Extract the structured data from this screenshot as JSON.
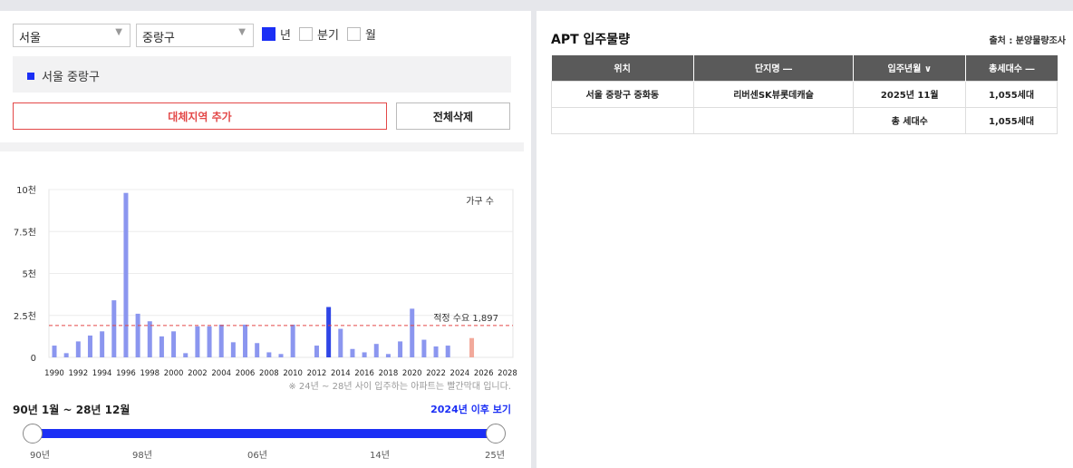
{
  "filters": {
    "city": "서울",
    "district": "중랑구",
    "period_options": [
      {
        "label": "년",
        "checked": true
      },
      {
        "label": "분기",
        "checked": false
      },
      {
        "label": "월",
        "checked": false
      }
    ]
  },
  "regions": [
    "서울 중랑구"
  ],
  "buttons": {
    "add": "대체지역 추가",
    "delete_all": "전체삭제"
  },
  "chart_data": {
    "type": "bar",
    "title": "",
    "legend": "가구 수",
    "yticks": [
      "0",
      "2.5천",
      "5천",
      "7.5천",
      "10천"
    ],
    "ylim": [
      0,
      10000
    ],
    "x": [
      1990,
      1991,
      1992,
      1993,
      1994,
      1995,
      1996,
      1997,
      1998,
      1999,
      2000,
      2001,
      2002,
      2003,
      2004,
      2005,
      2006,
      2007,
      2008,
      2009,
      2010,
      2011,
      2012,
      2013,
      2014,
      2015,
      2016,
      2017,
      2018,
      2019,
      2020,
      2021,
      2022,
      2023,
      2024,
      2025,
      2026,
      2027,
      2028
    ],
    "xticks": [
      "1990",
      "1992",
      "1994",
      "1996",
      "1998",
      "2000",
      "2002",
      "2004",
      "2006",
      "2008",
      "2010",
      "2012",
      "2014",
      "2016",
      "2018",
      "2020",
      "2022",
      "2024",
      "2026",
      "2028"
    ],
    "values": [
      700,
      250,
      950,
      1300,
      1550,
      3400,
      9800,
      2600,
      2150,
      1250,
      1550,
      250,
      1850,
      1850,
      1950,
      900,
      1950,
      850,
      300,
      200,
      1950,
      0,
      700,
      3000,
      1700,
      500,
      300,
      800,
      200,
      950,
      2900,
      1050,
      650,
      700,
      0,
      1150,
      0,
      0,
      0
    ],
    "highlight_year": 2013,
    "future_year": 2025,
    "colors": {
      "bar": "#8b96ef",
      "highlight": "#2f45e6",
      "future": "#f2a99b",
      "reference": "#e34848"
    },
    "reference_line": {
      "value": 1897,
      "label": "적정 수요 1,897"
    }
  },
  "note": "※ 24년 ~ 28년 사이 입주하는 아파트는 빨간막대 입니다.",
  "range": {
    "title": "90년 1월 ~ 28년 12월",
    "link": "2024년 이후 보기",
    "ticks": [
      "90년",
      "98년",
      "06년",
      "14년",
      "25년"
    ]
  },
  "table": {
    "title": "APT 입주물량",
    "source": "출처 : 분양물량조사",
    "headers": [
      "위치",
      "단지명 ―",
      "입주년월 ∨",
      "총세대수 ―"
    ],
    "rows": [
      [
        "서울 중랑구 중화동",
        "리버센SK뷰롯데캐슬",
        "2025년 11월",
        "1,055세대"
      ],
      [
        "",
        "",
        "총 세대수",
        "1,055세대"
      ]
    ]
  }
}
